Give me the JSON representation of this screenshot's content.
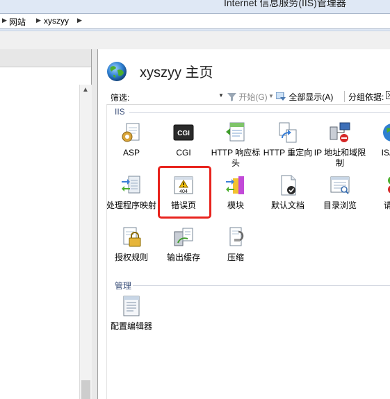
{
  "window": {
    "title": "Internet 信息服务(IIS)管理器"
  },
  "breadcrumb": [
    "网站",
    "xyszyy"
  ],
  "main": {
    "title": "xyszyy 主页",
    "filter": {
      "label": "筛选:",
      "value": "",
      "go_label": "开始(G)",
      "show_all_label": "全部显示(A)",
      "group_by_label": "分组依据:"
    },
    "groups": [
      {
        "title": "IIS",
        "items": [
          {
            "label": "ASP",
            "icon": "asp-icon"
          },
          {
            "label": "CGI",
            "icon": "cgi-icon"
          },
          {
            "label": "HTTP 响应标头",
            "icon": "http-response-headers-icon"
          },
          {
            "label": "HTTP 重定向",
            "icon": "http-redirect-icon"
          },
          {
            "label": "IP 地址和域限制",
            "icon": "ip-restrictions-icon"
          },
          {
            "label": "ISAPI",
            "icon": "isapi-icon"
          },
          {
            "label": "处理程序映射",
            "icon": "handler-mappings-icon"
          },
          {
            "label": "错误页",
            "icon": "error-pages-icon",
            "highlighted": true
          },
          {
            "label": "模块",
            "icon": "modules-icon"
          },
          {
            "label": "默认文档",
            "icon": "default-document-icon"
          },
          {
            "label": "目录浏览",
            "icon": "directory-browsing-icon"
          },
          {
            "label": "请求",
            "icon": "request-filtering-icon"
          },
          {
            "label": "授权规则",
            "icon": "authorization-rules-icon"
          },
          {
            "label": "输出缓存",
            "icon": "output-caching-icon"
          },
          {
            "label": "压缩",
            "icon": "compression-icon"
          }
        ]
      },
      {
        "title": "管理",
        "items": [
          {
            "label": "配置编辑器",
            "icon": "configuration-editor-icon"
          }
        ]
      }
    ]
  },
  "colors": {
    "highlight": "#e8231d",
    "group_title": "#3b4f7a",
    "chrome": "#dfe8f5"
  }
}
